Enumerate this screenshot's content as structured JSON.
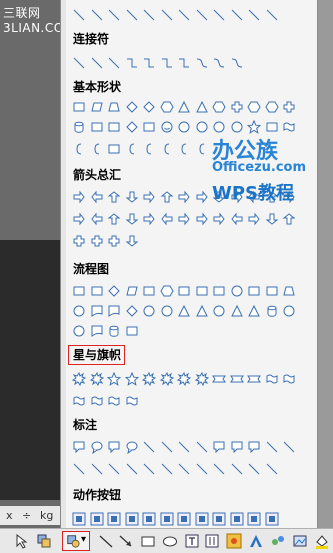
{
  "window": {
    "title": "三联网 3LIAN.COM"
  },
  "sections": [
    {
      "label": "连接符"
    },
    {
      "label": "基本形状"
    },
    {
      "label": "箭头总汇"
    },
    {
      "label": "流程图"
    },
    {
      "label": "星与旗帜"
    },
    {
      "label": "标注"
    },
    {
      "label": "动作按钮"
    }
  ],
  "watermark": {
    "line1": "办公族",
    "line2": "Officezu.com",
    "line3": "WPS教程"
  },
  "status": {
    "unit_x": "x",
    "unit_div": "÷",
    "unit_kg": "kg"
  },
  "toolbar": {
    "autoshape_arrow": "▾"
  },
  "colors": {
    "shape_stroke": "#3a6fb0",
    "shape_fill": "#ffffff",
    "highlight": "#dd2222",
    "watermark": "#2a84d6"
  }
}
